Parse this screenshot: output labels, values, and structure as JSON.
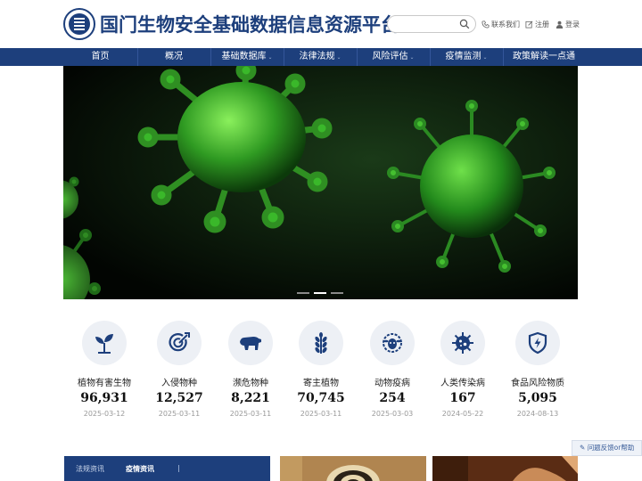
{
  "header": {
    "title": "国门生物安全基础数据信息资源平台",
    "search_placeholder": "",
    "links": {
      "contact": "联系我们",
      "register": "注册",
      "login": "登录"
    }
  },
  "nav": {
    "items": [
      {
        "label": "首页",
        "has_dropdown": false
      },
      {
        "label": "概况",
        "has_dropdown": false
      },
      {
        "label": "基础数据库",
        "has_dropdown": true
      },
      {
        "label": "法律法规",
        "has_dropdown": true
      },
      {
        "label": "风险评估",
        "has_dropdown": true
      },
      {
        "label": "疫情监测",
        "has_dropdown": true
      },
      {
        "label": "政策解读一点通",
        "has_dropdown": false
      }
    ]
  },
  "banner": {
    "slide_count": 3,
    "active_slide": 2
  },
  "stats": [
    {
      "label": "植物有害生物",
      "value": "96,931",
      "date": "2025-03-12",
      "icon": "plant-sprout-icon"
    },
    {
      "label": "入侵物种",
      "value": "12,527",
      "date": "2025-03-11",
      "icon": "target-arrow-icon"
    },
    {
      "label": "濒危物种",
      "value": "8,221",
      "date": "2025-03-11",
      "icon": "bear-icon"
    },
    {
      "label": "寄主植物",
      "value": "70,745",
      "date": "2025-03-11",
      "icon": "wheat-icon"
    },
    {
      "label": "动物疫病",
      "value": "254",
      "date": "2025-03-03",
      "icon": "sheep-icon"
    },
    {
      "label": "人类传染病",
      "value": "167",
      "date": "2024-05-22",
      "icon": "virus-icon"
    },
    {
      "label": "食品风险物质",
      "value": "5,095",
      "date": "2024-08-13",
      "icon": "shield-lightning-icon"
    }
  ],
  "feedback": {
    "label": "问题反馈or帮助"
  },
  "news": {
    "tabs": [
      {
        "label": "法规资讯",
        "active": false
      },
      {
        "label": "疫情资讯",
        "active": true
      }
    ]
  },
  "colors": {
    "brand": "#1d3f7c",
    "icon_bg": "#edf0f5",
    "date": "#999999"
  }
}
